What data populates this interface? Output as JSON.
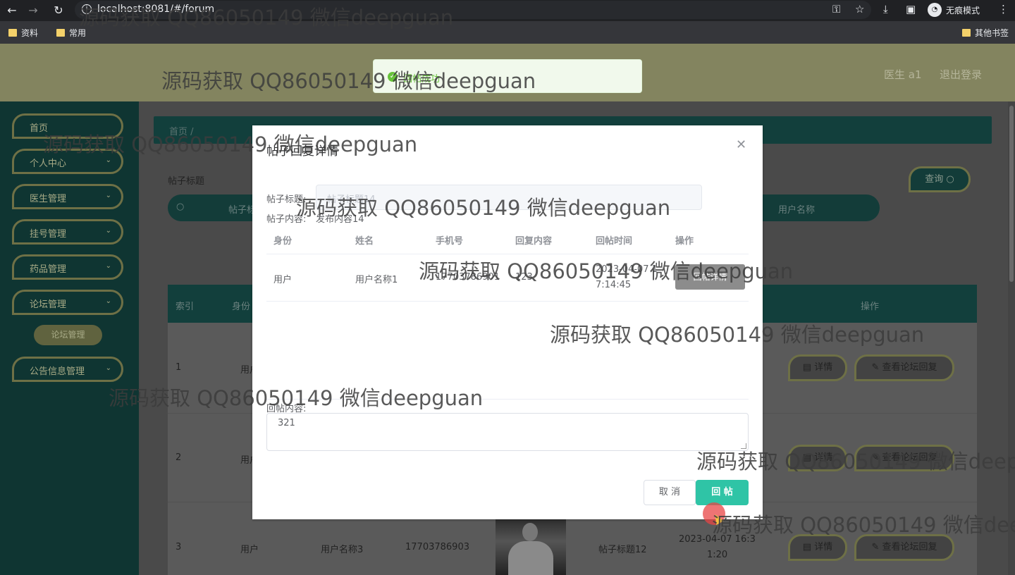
{
  "browser": {
    "url": "localhost:8081/#/forum",
    "incognito_label": "无痕模式",
    "bookmarks": [
      "资料",
      "常用"
    ],
    "other_bookmarks": "其他书签"
  },
  "header": {
    "user_label": "医生 a1",
    "logout_label": "退出登录"
  },
  "toast": {
    "message": "回帖成功"
  },
  "sidebar": {
    "items": [
      {
        "label": "首页",
        "chevron": ""
      },
      {
        "label": "个人中心",
        "chevron": "⌄"
      },
      {
        "label": "医生管理",
        "chevron": "⌄"
      },
      {
        "label": "挂号管理",
        "chevron": "⌄"
      },
      {
        "label": "药品管理",
        "chevron": "⌄"
      },
      {
        "label": "论坛管理",
        "chevron": "⌄"
      }
    ],
    "sub_item": "论坛管理",
    "last_item": {
      "label": "公告信息管理",
      "chevron": "⌄"
    }
  },
  "main": {
    "breadcrumb": "首页 /",
    "search_label": "帖子标题",
    "search_placeholder_left": "帖子标",
    "search_placeholder_right": "用户名称",
    "query_button": "查询 ○",
    "table": {
      "headers": [
        "索引",
        "身份",
        "操作"
      ],
      "rows": [
        {
          "index": "1",
          "role": "用户"
        },
        {
          "index": "2",
          "role": "用户"
        },
        {
          "index": "3",
          "role": "用户",
          "name": "用户名称3",
          "phone": "17703786903",
          "title": "帖子标题12",
          "time_line1": "2023-04-07 16:3",
          "time_line2": "1:20"
        }
      ],
      "action_detail": "详情",
      "action_view_replies": "查看论坛回复"
    }
  },
  "dialog": {
    "title": "帖子回复详情",
    "post_title_label": "帖子标题:",
    "post_title_value": "帖子标题14",
    "post_content_label": "帖子内容:",
    "post_content_value": "发布内容14",
    "columns": [
      "身份",
      "姓名",
      "手机号",
      "回复内容",
      "回帖时间",
      "操作"
    ],
    "rows": [
      {
        "role": "用户",
        "name": "用户名称1",
        "phone": "17703786901",
        "reply": "123",
        "time_line1": "2023-04-07 1",
        "time_line2": "7:14:45",
        "action": "回帖详情"
      }
    ],
    "reply_label": "回帖内容:",
    "reply_value": "321",
    "cancel_label": "取 消",
    "submit_label": "回 帖"
  },
  "watermark": "源码获取 QQ86050149 微信deepguan"
}
